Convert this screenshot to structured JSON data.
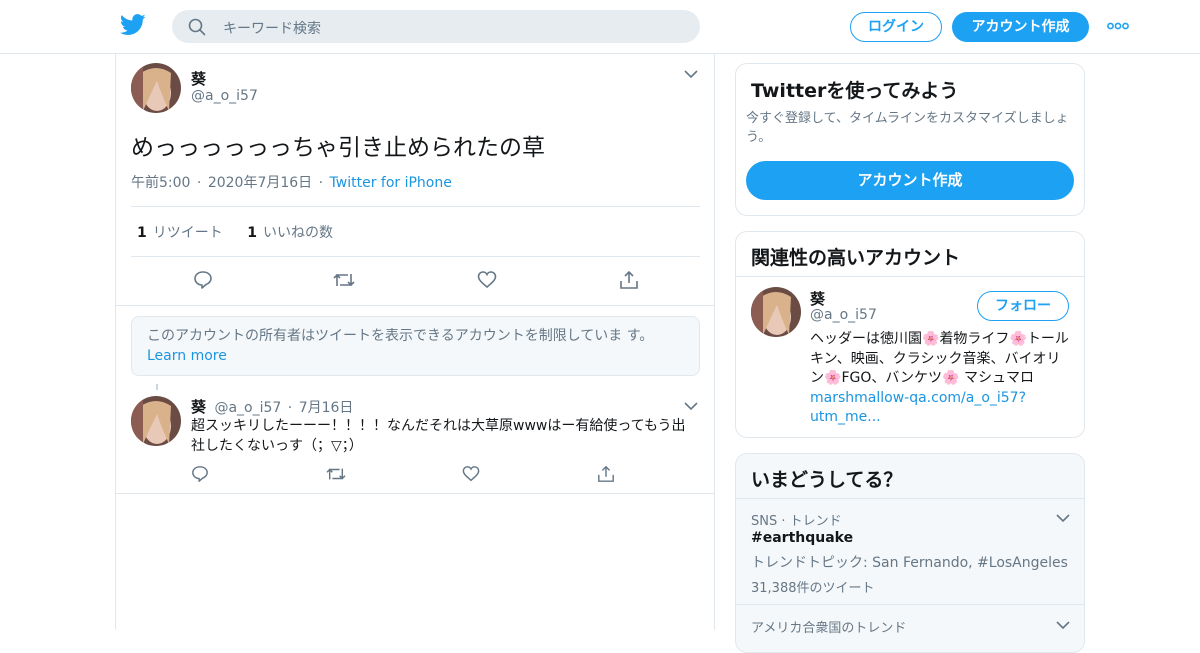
{
  "header": {
    "search_placeholder": "キーワード検索",
    "login_label": "ログイン",
    "signup_label": "アカウント作成"
  },
  "tweet": {
    "name": "葵",
    "handle": "@a_o_i57",
    "text": "めっっっっっっちゃ引き止められたの草",
    "time": "午前5:00",
    "date": "2020年7月16日",
    "source": "Twitter for iPhone",
    "retweet_count": "1",
    "retweet_label": "リツイート",
    "like_count": "1",
    "like_label": "いいねの数"
  },
  "notice": {
    "text": "このアカウントの所有者はツイートを表示できるアカウントを制限していま す。",
    "link": "Learn more"
  },
  "reply": {
    "name": "葵",
    "handle": "@a_o_i57",
    "date": "7月16日",
    "text": "超スッキリしたーーー！！！！なんだそれは大草原wwwはー有給使ってもう出社したくないっす（；▽；）"
  },
  "signup_card": {
    "title": "Twitterを使ってみよう",
    "description": "今すぐ登録して、タイムラインをカスタマイズしましょう。",
    "button": "アカウント作成"
  },
  "related_card": {
    "title": "関連性の高いアカウント",
    "name": "葵",
    "handle": "@a_o_i57",
    "follow": "フォロー",
    "bio_1": "ヘッダーは徳川園",
    "bio_2": "着物ライフ",
    "bio_3": "トールキン、映画、クラシック音楽、バイオリン",
    "bio_4": "FGO、バンケツ",
    "bio_5": " マシュマロ",
    "bio_link": "marshmallow-qa.com/a_o_i57?utm_me...",
    "emoji": "🌸"
  },
  "trends_card": {
    "title": "いまどうしてる？",
    "trends": [
      {
        "meta": "SNS · トレンド",
        "name": "#earthquake",
        "topic": "トレンドトピック: San Fernando, #LosAngeles",
        "count": "31,388件のツイート"
      },
      {
        "meta": "アメリカ合衆国のトレンド"
      }
    ]
  },
  "colors": {
    "accent": "#1da1f2",
    "link": "#1b95e0",
    "secondary_text": "#657786",
    "border": "#e1e8ed"
  },
  "icons": [
    "twitter-bird-icon",
    "search-icon",
    "more-dots-icon",
    "chevron-down-icon",
    "reply-icon",
    "retweet-icon",
    "like-icon",
    "share-icon"
  ]
}
